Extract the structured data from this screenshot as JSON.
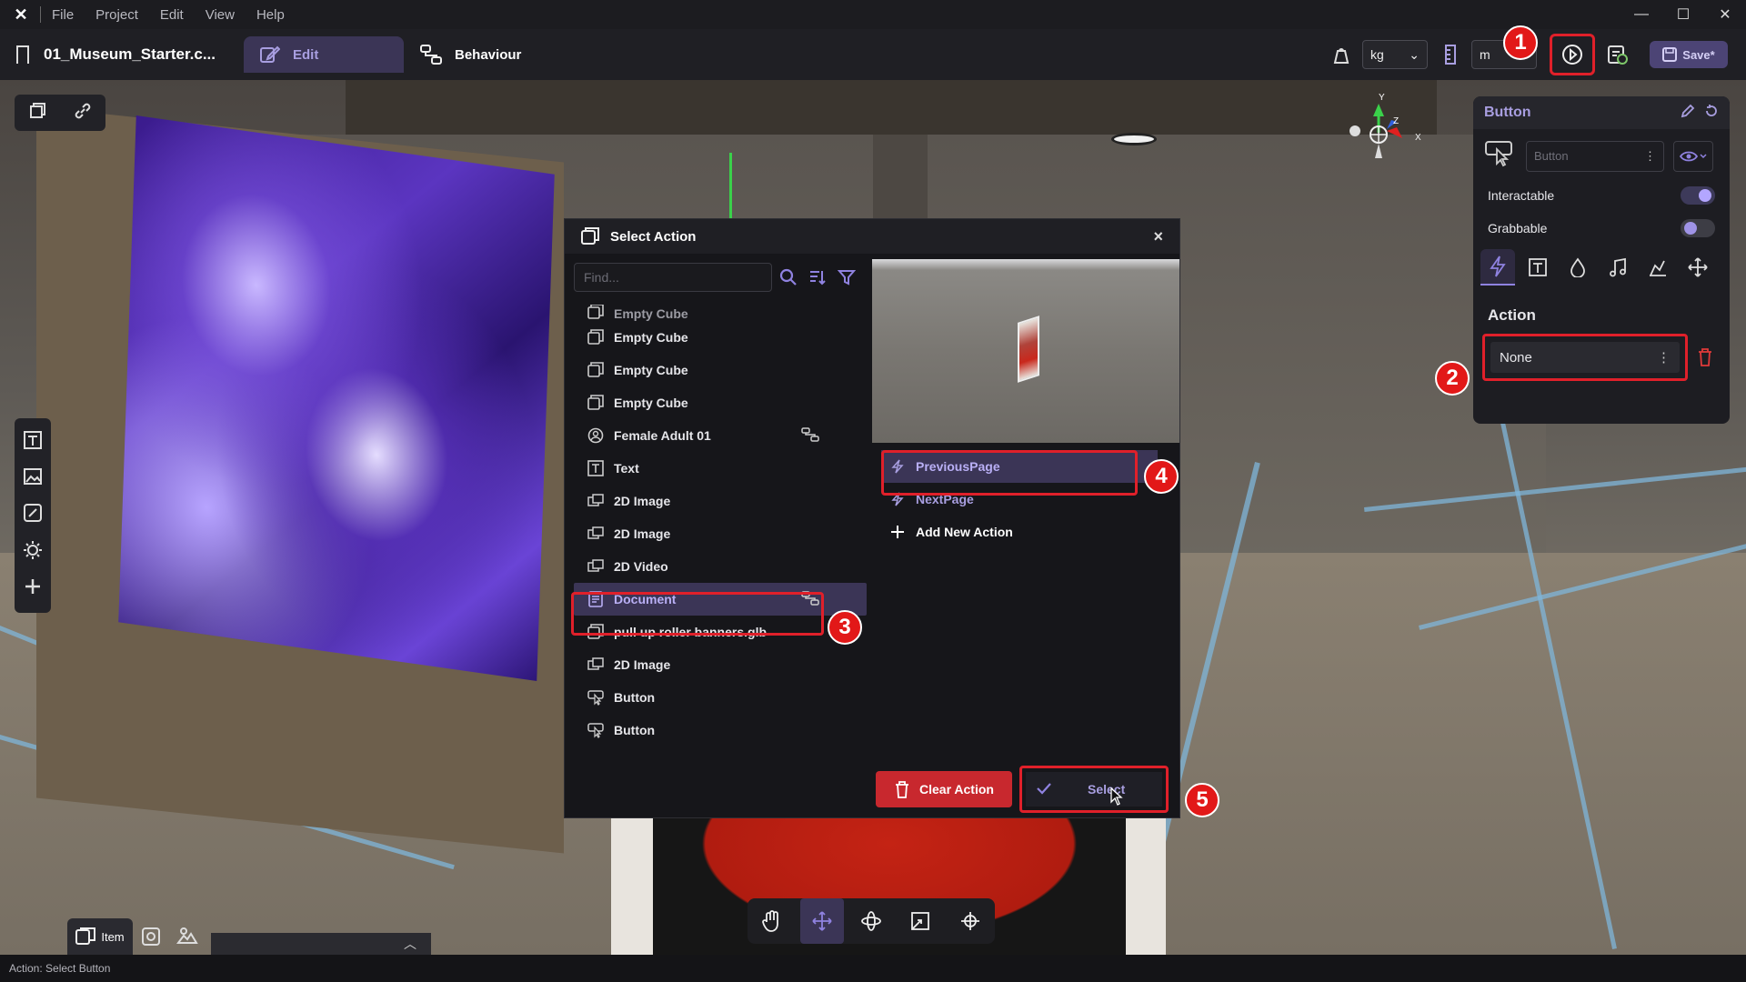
{
  "menubar": {
    "logo": "✕",
    "items": [
      "File",
      "Project",
      "Edit",
      "View",
      "Help"
    ],
    "window_controls": [
      "—",
      "☐",
      "✕"
    ]
  },
  "toolbar": {
    "project_name": "01_Museum_Starter.c...",
    "tabs": [
      {
        "label": "Edit",
        "active": true
      },
      {
        "label": "Behaviour",
        "active": false
      }
    ],
    "mass_unit": "kg",
    "length_unit": "m",
    "save_label": "Save*"
  },
  "props": {
    "title": "Button",
    "name_placeholder": "Button",
    "interactable_label": "Interactable",
    "interactable_on": true,
    "grabbable_label": "Grabbable",
    "grabbable_on": false,
    "action_label": "Action",
    "action_value": "None"
  },
  "dialog": {
    "title": "Select Action",
    "search_placeholder": "Find...",
    "objects": [
      {
        "label": "Empty Cube",
        "icon": "cube-icon",
        "clipped": true
      },
      {
        "label": "Empty Cube",
        "icon": "cube-icon"
      },
      {
        "label": "Empty Cube",
        "icon": "cube-icon"
      },
      {
        "label": "Empty Cube",
        "icon": "cube-icon"
      },
      {
        "label": "Female Adult 01",
        "icon": "avatar-icon",
        "behaviour": true
      },
      {
        "label": "Text",
        "icon": "text-icon"
      },
      {
        "label": "2D Image",
        "icon": "image-icon"
      },
      {
        "label": "2D Image",
        "icon": "image-icon"
      },
      {
        "label": "2D Video",
        "icon": "image-icon"
      },
      {
        "label": "Document",
        "icon": "document-icon",
        "behaviour": true,
        "selected": true
      },
      {
        "label": "pull up roller banners.glb",
        "icon": "cube-icon"
      },
      {
        "label": "2D Image",
        "icon": "image-icon"
      },
      {
        "label": "Button",
        "icon": "button-icon"
      },
      {
        "label": "Button",
        "icon": "button-icon"
      }
    ],
    "actions": [
      {
        "label": "PreviousPage",
        "selected": true
      },
      {
        "label": "NextPage",
        "selected": false
      }
    ],
    "add_action_label": "Add New Action",
    "clear_label": "Clear Action",
    "select_label": "Select"
  },
  "markers": [
    "1",
    "2",
    "3",
    "4",
    "5"
  ],
  "gizmo": {
    "y": "Y",
    "x": "X",
    "z": "Z"
  },
  "bottom": {
    "item_tab": "Item"
  },
  "status": "Action: Select Button",
  "colors": {
    "accent": "#a89ee0",
    "selected_bg": "#3b3556",
    "highlight": "#e0202a",
    "danger": "#c8282e"
  }
}
